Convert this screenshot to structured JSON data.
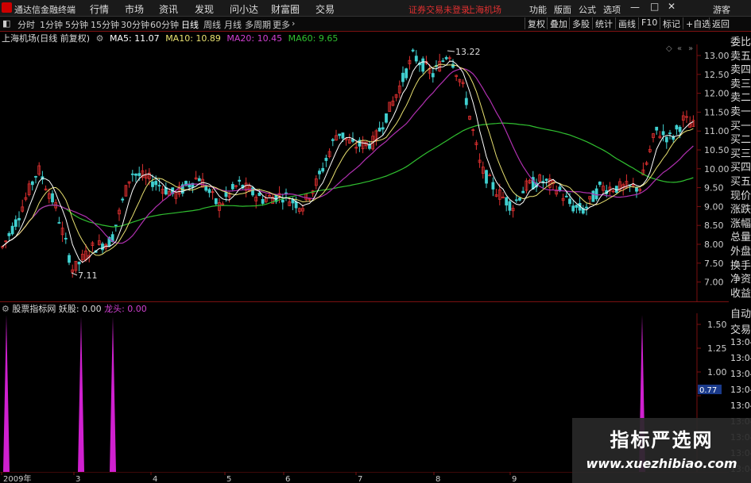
{
  "menubar": {
    "app_title": "通达信金融终端",
    "menus": [
      "行情",
      "市场",
      "资讯",
      "发现",
      "问小达",
      "财富圈",
      "交易"
    ],
    "notice": "证券交易未登录",
    "stock_name": "上海机场",
    "right_items": [
      "功能",
      "版面",
      "公式",
      "选项"
    ],
    "guest": "游客"
  },
  "periodbar": {
    "periods": [
      "分时",
      "1分钟",
      "5分钟",
      "15分钟",
      "30分钟",
      "60分钟",
      "日线",
      "周线",
      "月线",
      "多周期",
      "更多"
    ],
    "active": "日线",
    "right_buttons": [
      "复权",
      "叠加",
      "多股",
      "统计",
      "画线",
      "F10",
      "标记",
      "+自选",
      "返回"
    ]
  },
  "info": {
    "title": "上海机场(日线 前复权)",
    "ma5_label": "MA5: 11.07",
    "ma10_label": "MA10: 10.89",
    "ma20_label": "MA20: 10.45",
    "ma60_label": "MA60: 9.65",
    "colors": {
      "ma5": "#ffffff",
      "ma10": "#e8e070",
      "ma20": "#d040d0",
      "ma60": "#30c030"
    }
  },
  "price_chart": {
    "y_ticks": [
      "13.00",
      "12.50",
      "12.00",
      "11.50",
      "11.00",
      "10.50",
      "10.00",
      "9.50",
      "9.00",
      "8.50",
      "8.00",
      "7.50",
      "7.00"
    ],
    "high_label": "13.22",
    "low_label": "7.11"
  },
  "indicator": {
    "name": "股票指标网",
    "field1": "妖股: 0.00",
    "field2": "龙头: 0.00",
    "y_ticks": [
      "1.50",
      "1.25",
      "1.00",
      "0.75"
    ],
    "current_value": "0.77"
  },
  "x_axis": {
    "labels": [
      "2009年",
      "3",
      "4",
      "5",
      "6",
      "7",
      "8",
      "9"
    ]
  },
  "side_panel": {
    "items": [
      "委比",
      "卖五",
      "卖四",
      "卖三",
      "卖二",
      "卖一",
      "买一",
      "买二",
      "买三",
      "买四",
      "买五",
      "现价",
      "涨跌",
      "涨幅",
      "总量",
      "外盘",
      "换手",
      "净资",
      "收益"
    ]
  },
  "side_panel2": {
    "items": [
      "自动",
      "交易",
      "13:04",
      "13:04",
      "13:04",
      "13:04",
      "13:04",
      "13:04",
      "13:04",
      "13:04",
      "13:04"
    ]
  },
  "watermark": {
    "title": "指标严选网",
    "url": "www.xuezhibiao.com"
  }
}
